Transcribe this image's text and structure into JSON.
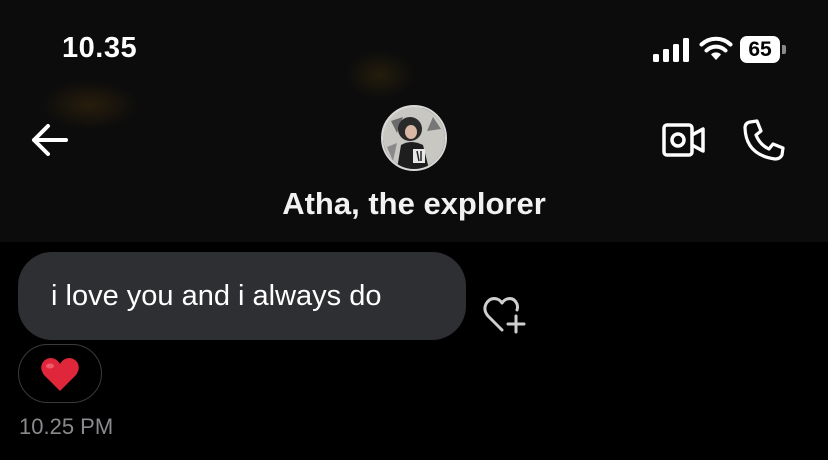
{
  "status_bar": {
    "time": "10.35",
    "battery": "65",
    "icons": [
      "signal-icon",
      "wifi-icon",
      "battery-icon"
    ]
  },
  "header": {
    "contact_name": "Atha, the explorer",
    "icons": [
      "back-arrow-icon",
      "avatar",
      "video-call-icon",
      "phone-call-icon"
    ]
  },
  "message": {
    "text": "i love you and i always do",
    "timestamp": "10.25 PM",
    "reaction_icon": "red-heart-icon",
    "add_reaction_icon": "heart-plus-icon"
  },
  "colors": {
    "background": "#000000",
    "header_background": "#0c0c0c",
    "bubble": "#2e2f32",
    "timestamp": "#8a8a8e",
    "heart": "#e0263a"
  }
}
